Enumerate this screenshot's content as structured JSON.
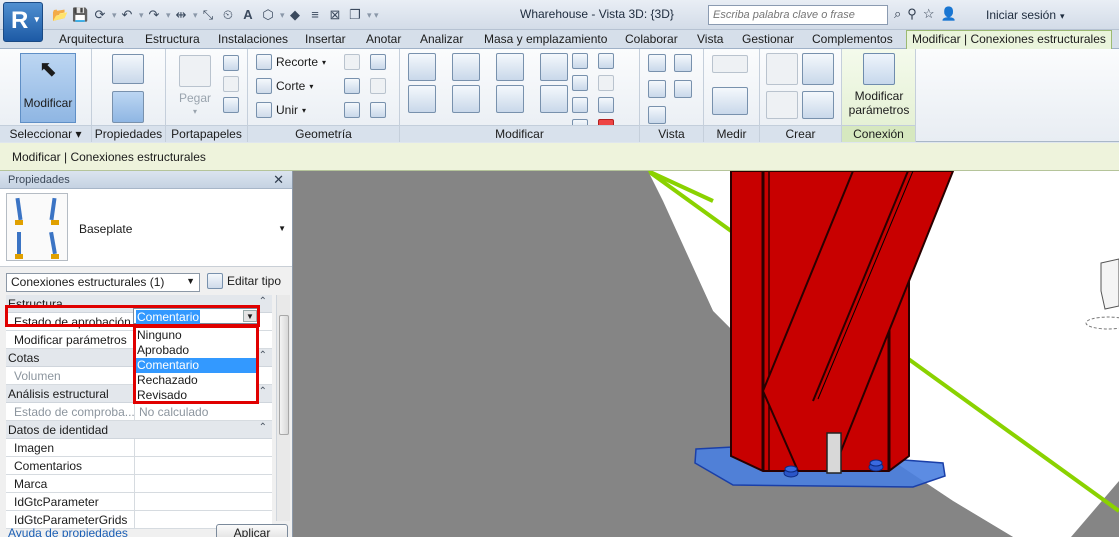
{
  "app": {
    "logo_letter": "R",
    "document_title": "Wharehouse - Vista 3D: {3D}"
  },
  "search": {
    "placeholder": "Escriba palabra clave o frase"
  },
  "account": {
    "signin_label": "Iniciar sesión"
  },
  "tabs": [
    {
      "label": "Arquitectura"
    },
    {
      "label": "Estructura"
    },
    {
      "label": "Instalaciones"
    },
    {
      "label": "Insertar"
    },
    {
      "label": "Anotar"
    },
    {
      "label": "Analizar"
    },
    {
      "label": "Masa y emplazamiento"
    },
    {
      "label": "Colaborar"
    },
    {
      "label": "Vista"
    },
    {
      "label": "Gestionar"
    },
    {
      "label": "Complementos"
    },
    {
      "label": "Modificar | Conexiones estructurales"
    }
  ],
  "ribbon": {
    "modify_button": "Modificar",
    "paste_button": "Pegar",
    "geometry": {
      "trim": "Recorte",
      "cut": "Corte",
      "join": "Unir"
    },
    "connection_button_line1": "Modificar",
    "connection_button_line2": "parámetros",
    "panels": {
      "select": "Seleccionar",
      "properties": "Propiedades",
      "clipboard": "Portapapeles",
      "geometry": "Geometría",
      "modify": "Modificar",
      "view": "Vista",
      "measure": "Medir",
      "create": "Crear",
      "connection": "Conexión"
    }
  },
  "context_bar": {
    "text": "Modificar | Conexiones estructurales"
  },
  "properties": {
    "title": "Propiedades",
    "type_name": "Baseplate",
    "filter": "Conexiones estructurales (1)",
    "edit_type": "Editar tipo",
    "sections": {
      "structure": "Estructura",
      "dimensions": "Cotas",
      "analysis": "Análisis estructural",
      "identity": "Datos de identidad"
    },
    "rows": {
      "approval": {
        "name": "Estado de aprobación",
        "value": "Comentario"
      },
      "modify_params": {
        "name": "Modificar parámetros"
      },
      "volume": {
        "name": "Volumen"
      },
      "check_status": {
        "name": "Estado de comproba...",
        "value": "No calculado"
      },
      "image": {
        "name": "Imagen"
      },
      "comments": {
        "name": "Comentarios"
      },
      "mark": {
        "name": "Marca"
      },
      "gtc_param": {
        "name": "IdGtcParameter"
      },
      "gtc_grids": {
        "name": "IdGtcParameterGrids"
      }
    },
    "dropdown_options": [
      "Ninguno",
      "Aprobado",
      "Comentario",
      "Rechazado",
      "Revisado"
    ],
    "help_link": "Ayuda de propiedades",
    "apply_button": "Aplicar"
  },
  "colors": {
    "steel_red": "#c80000",
    "baseplate_blue": "#4a7fe0",
    "highlight": "#3399ff",
    "annotation_red": "#e00000",
    "context_green": "#eaf4dc"
  }
}
